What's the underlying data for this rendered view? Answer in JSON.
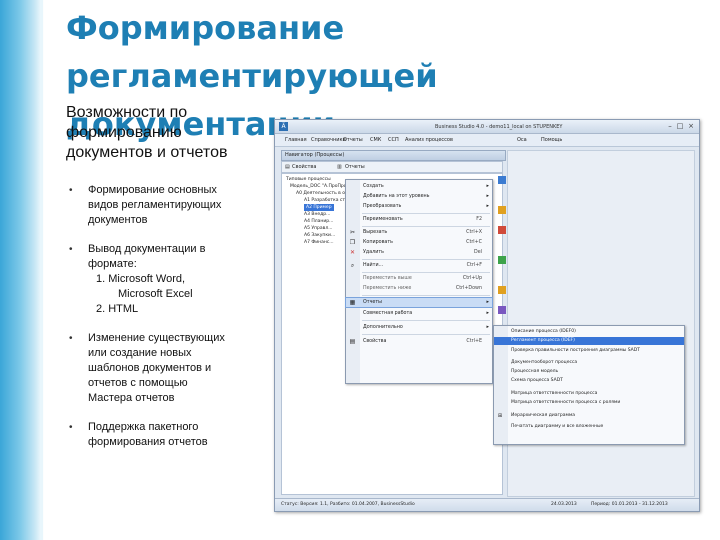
{
  "slide": {
    "title_line1": "Формирование",
    "title_line2": "регламентирующей документации",
    "subheading_lines": [
      "Возможности по",
      "формированию",
      "документов и отчетов"
    ],
    "bullet1_lines": [
      "Формирование основных",
      "видов регламентирующих",
      "документов"
    ],
    "bullet2_lines": [
      "Вывод документации в",
      "формате:"
    ],
    "bullet2_sub": [
      "1. Microsoft Word,",
      "Microsoft Excel",
      "2. HTML"
    ],
    "bullet3_lines": [
      "Изменение существующих",
      "или создание новых",
      "шаблонов документов  и",
      "отчетов с помощью",
      "Мастера отчетов"
    ],
    "bullet4_lines": [
      "Поддержка пакетного",
      "формирования отчетов"
    ]
  },
  "window": {
    "title": "Business Studio 4.0 - demo11_local on STUPENKEY",
    "menu": [
      "Главная",
      "Справочники",
      "Отчеты",
      "СМК",
      "ССП",
      "Анализ процессов",
      "Оса",
      "Помощь"
    ],
    "navigator_title": "Навигатор (Процессы)",
    "toolbar": [
      "Свойства",
      "Отчеты"
    ],
    "tree": [
      "Типовые процессы",
      "Модель_DOC \"А.ПроПроект\"",
      "А0 Деятельность в области предоставления консалтинговых услуг",
      "А1 Разработка стратегии и развития бизнеса",
      "А2 Пример",
      "А3 Внедр...",
      "А4 Планир...",
      "А5 Управл...",
      "А6 Закупки...",
      "А7 Финанс..."
    ],
    "context_menu": [
      {
        "label": "Создать",
        "shortcut": "",
        "arrow": "▸"
      },
      {
        "label": "Добавить на этот уровень",
        "shortcut": "",
        "arrow": "▸"
      },
      {
        "label": "Преобразовать",
        "shortcut": "",
        "arrow": "▸"
      },
      {
        "label": "Переименовать",
        "shortcut": "F2",
        "arrow": ""
      },
      {
        "label": "Вырезать",
        "shortcut": "Ctrl+X",
        "arrow": ""
      },
      {
        "label": "Копировать",
        "shortcut": "Ctrl+C",
        "arrow": ""
      },
      {
        "label": "Удалить",
        "shortcut": "Del",
        "arrow": ""
      },
      {
        "label": "Найти...",
        "shortcut": "Ctrl+F",
        "arrow": ""
      },
      {
        "label": "Переместить выше",
        "shortcut": "Ctrl+Up",
        "arrow": ""
      },
      {
        "label": "Переместить ниже",
        "shortcut": "Ctrl+Down",
        "arrow": ""
      },
      {
        "label": "Отчеты",
        "shortcut": "",
        "arrow": "▸"
      },
      {
        "label": "Совместная работа",
        "shortcut": "",
        "arrow": "▸"
      },
      {
        "label": "Дополнительно",
        "shortcut": "",
        "arrow": "▸"
      },
      {
        "label": "Свойства",
        "shortcut": "Ctrl+E",
        "arrow": ""
      }
    ],
    "submenu": [
      "Описание процесса (IDEF0)",
      "Регламент процесса (IDEF)",
      "Проверка правильности построения диаграммы SADT",
      "Документооборот процесса",
      "Процессная модель",
      "Схема процесса SADT",
      "Матрица ответственности процесса",
      "Матрица ответственности процесса с ролями",
      "Иерархическая диаграмма",
      "Печатать диаграмму и все вложенные"
    ],
    "status_left": "Статус: Версия: 1.1, Разбито: 01.04.2007, BusinessStudio",
    "status_right1": "24.03.2013",
    "status_right2": "Период: 01.01.2013 - 31.12.2013"
  }
}
